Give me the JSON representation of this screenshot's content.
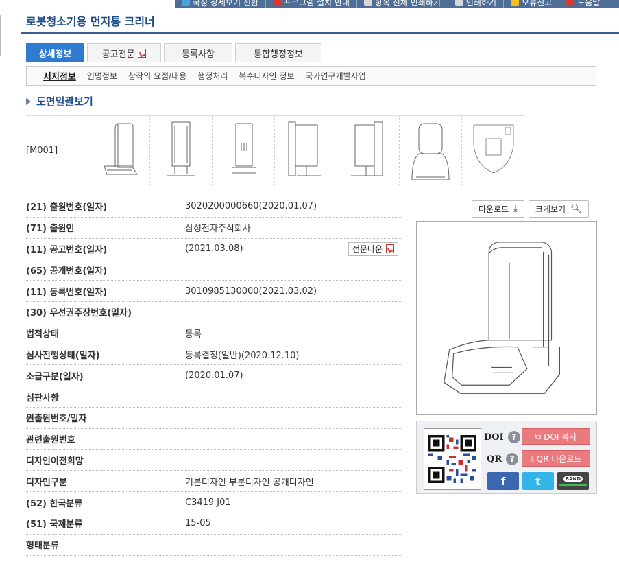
{
  "topbar": {
    "items": [
      {
        "label": "국정 상세보기 전환",
        "icon": "globe-icon",
        "color": "#4ba3e0"
      },
      {
        "label": "프로그램 설치 안내",
        "icon": "pdf-icon",
        "color": "#d9392e"
      },
      {
        "label": "항목 전체 인쇄하기",
        "icon": "printer-icon",
        "color": "#d8d8d8"
      },
      {
        "label": "인쇄하기",
        "icon": "printer-icon",
        "color": "#d8d8d8"
      },
      {
        "label": "오류신고",
        "icon": "warning-icon",
        "color": "#f3c21a"
      },
      {
        "label": "도움말",
        "icon": "help-icon",
        "color": "#d9392e"
      }
    ]
  },
  "page": {
    "title": "로봇청소기용 먼지통 크리너"
  },
  "tabs": [
    {
      "label": "상세정보",
      "active": true
    },
    {
      "label": "공고전문",
      "pdf": true
    },
    {
      "label": "등록사항"
    },
    {
      "label": "통합행정정보"
    }
  ],
  "subtabs": [
    {
      "label": "서지정보",
      "active": true
    },
    {
      "label": "인명정보"
    },
    {
      "label": "창작의 요점/내용"
    },
    {
      "label": "행정처리"
    },
    {
      "label": "복수디자인 정보"
    },
    {
      "label": "국가연구개발사업"
    }
  ],
  "drawings": {
    "section_title": "도면일괄보기",
    "label": "[M001]",
    "count": 7
  },
  "info": {
    "rows": [
      {
        "label": "(21) 출원번호(일자)",
        "value": "3020200000660(2020.01.07)"
      },
      {
        "label": "(71) 출원인",
        "value": "삼성전자주식회사"
      },
      {
        "label": "(11) 공고번호(일자)",
        "value": "(2021.03.08)",
        "button": "전문다운"
      },
      {
        "label": "(65) 공개번호(일자)",
        "value": ""
      },
      {
        "label": "(11) 등록번호(일자)",
        "value": "3010985130000(2021.03.02)"
      },
      {
        "label": "(30) 우선권주장번호(일자)",
        "value": ""
      },
      {
        "label": "법적상태",
        "value": "등록"
      },
      {
        "label": "심사진행상태(일자)",
        "value": "등록결정(일반)(2020.12.10)"
      },
      {
        "label": "소급구분(일자)",
        "value": "(2020.01.07)"
      },
      {
        "label": "심판사항",
        "value": ""
      },
      {
        "label": "원출원번호/일자",
        "value": ""
      },
      {
        "label": "관련출원번호",
        "value": ""
      },
      {
        "label": "디자인이전희망",
        "value": ""
      },
      {
        "label": "디자인구분",
        "value": "기본디자인 부분디자인 공개디자인"
      },
      {
        "label": "(52) 한국분류",
        "value": "C3419    J01"
      },
      {
        "label": "(51) 국제분류",
        "value": "15-05"
      },
      {
        "label": "형태분류",
        "value": ""
      }
    ]
  },
  "right_panel": {
    "download_label": "다운로드",
    "zoom_label": "크게보기",
    "doi_label": "DOI",
    "qr_label": "QR",
    "doi_button": "DOI 복사",
    "qr_button": "QR 다운로드",
    "social": [
      {
        "label": "f",
        "icon": "facebook-icon",
        "color": "#3b66b0"
      },
      {
        "label": "t",
        "icon": "twitter-icon",
        "color": "#33b5e8"
      },
      {
        "label": "BAND",
        "icon": "band-icon",
        "color": "#444444"
      }
    ]
  }
}
